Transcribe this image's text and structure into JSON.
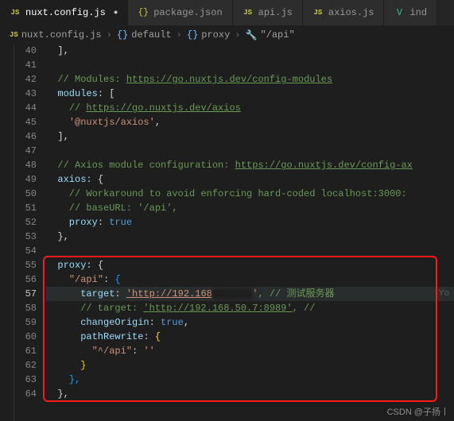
{
  "tabs": [
    {
      "name": "nuxt.config.js",
      "icon": "JS",
      "active": true,
      "modified": true
    },
    {
      "name": "package.json",
      "icon": "{}",
      "active": false
    },
    {
      "name": "api.js",
      "icon": "JS",
      "active": false
    },
    {
      "name": "axios.js",
      "icon": "JS",
      "active": false
    },
    {
      "name": "ind",
      "icon": "V",
      "active": false
    }
  ],
  "breadcrumb": {
    "file": "nuxt.config.js",
    "seg1": "default",
    "seg2": "proxy",
    "seg3": "\"/api\""
  },
  "lines": {
    "start": 40,
    "active": 57,
    "l40": "  ],",
    "l41": "",
    "l42_c": "  // Modules: ",
    "l42_l": "https://go.nuxtjs.dev/config-modules",
    "l43_k": "  modules",
    "l43_r": ": [",
    "l44_c": "    // ",
    "l44_l": "https://go.nuxtjs.dev/axios",
    "l45_s": "'@nuxtjs/axios'",
    "l46": "  ],",
    "l47": "",
    "l48_c": "  // Axios module configuration: ",
    "l48_l": "https://go.nuxtjs.dev/config-ax",
    "l49_k": "  axios",
    "l49_r": ": {",
    "l50_c": "    // Workaround to avoid enforcing hard-coded localhost:3000: ",
    "l51_c": "    // baseURL: '/api',",
    "l52_k": "    proxy",
    "l52_v": "true",
    "l53": "  },",
    "l54": "",
    "l55_k": "  proxy",
    "l55_r": ": {",
    "l56_s": "\"/api\"",
    "l57_k": "      target",
    "l57_s": "'http://192.168",
    "l57_blur": "XXXXXXX",
    "l57_c": ", // 测试服务器",
    "l57_hint": "Yo",
    "l58_c": "      // target: ",
    "l58_l": "'http://192.168.50.7:8989'",
    "l58_c2": ", //",
    "l59_k": "      changeOrigin",
    "l59_v": "true",
    "l60_k": "      pathRewrite",
    "l61_s": "\"^/api\"",
    "l61_v": "''",
    "l62": "      }",
    "l63": "    },",
    "l64": "  },"
  },
  "watermark": "CSDN @子扬丨"
}
